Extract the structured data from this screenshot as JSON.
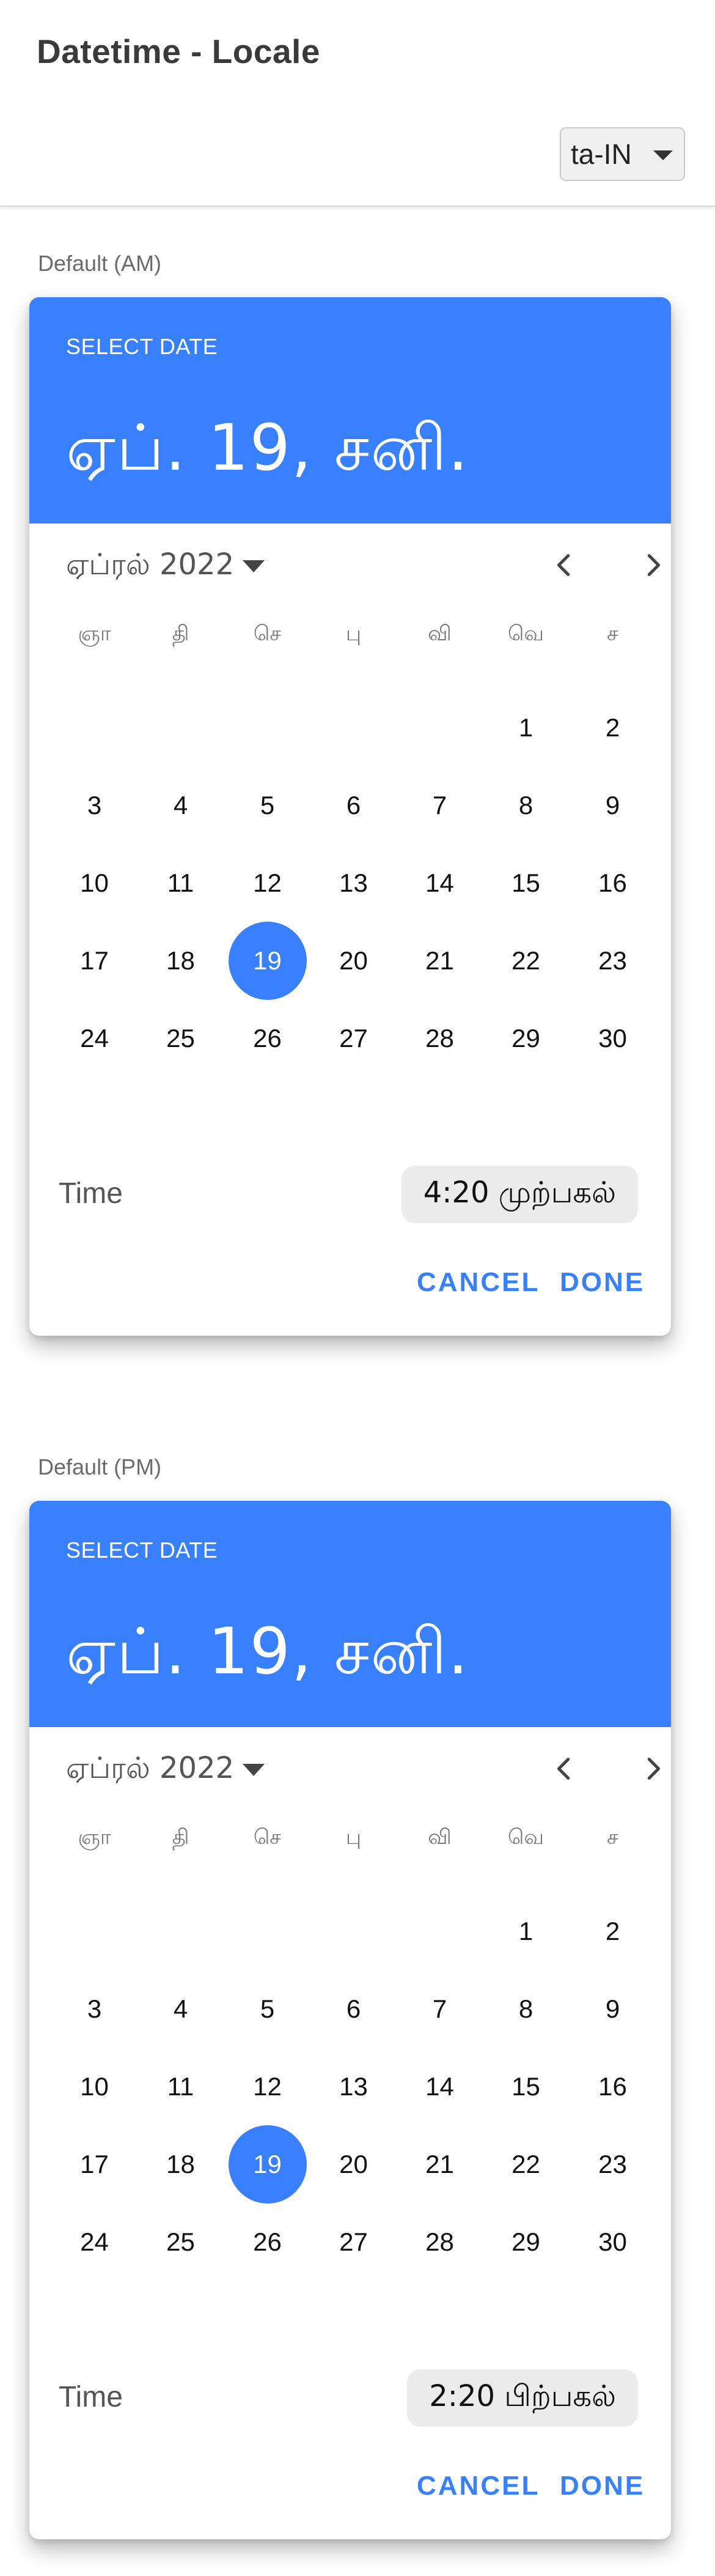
{
  "page": {
    "title": "Datetime - Locale"
  },
  "locale_select": {
    "value": "ta-IN"
  },
  "weekdays": [
    "ஞா",
    "தி",
    "செ",
    "பு",
    "வி",
    "வெ",
    "ச"
  ],
  "pickers": [
    {
      "section_label": "Default (AM)",
      "header_label": "SELECT DATE",
      "header_date": "ஏப். 19, சனி.",
      "month_label": "ஏப்ரல் 2022",
      "first_weekday_index": 5,
      "days_in_month": 30,
      "selected_day": 19,
      "time_label": "Time",
      "time_value": "4:20 முற்பகல்",
      "cancel_label": "CANCEL",
      "done_label": "DONE"
    },
    {
      "section_label": "Default (PM)",
      "header_label": "SELECT DATE",
      "header_date": "ஏப். 19, சனி.",
      "month_label": "ஏப்ரல் 2022",
      "first_weekday_index": 5,
      "days_in_month": 30,
      "selected_day": 19,
      "time_label": "Time",
      "time_value": "2:20 பிற்பகல்",
      "cancel_label": "CANCEL",
      "done_label": "DONE"
    }
  ],
  "colors": {
    "accent": "#3880ff",
    "time_bg": "#ececec"
  }
}
